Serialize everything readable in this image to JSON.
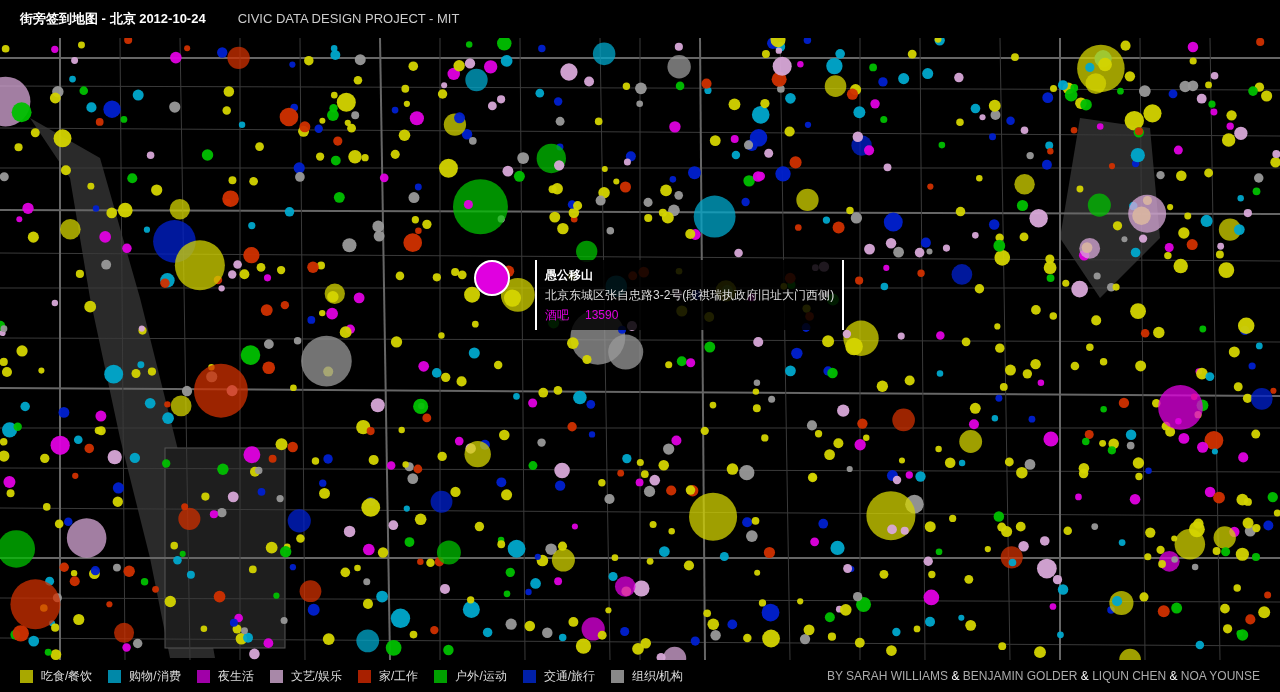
{
  "header": {
    "title": "街旁签到地图 - 北京 2012-10-24",
    "subtitle": "CIVIC DATA DESIGN PROJECT - MIT"
  },
  "tooltip": {
    "name": "愚公移山",
    "address": "北京东城区张自忠路3-2号(段祺瑞执政府旧址大门西侧)",
    "category": "酒吧",
    "count": "13590",
    "color": "#e000e0"
  },
  "legend": [
    {
      "label": "吃食/餐饮",
      "color": "#a8a800"
    },
    {
      "label": "购物/消费",
      "color": "#0088a8"
    },
    {
      "label": "夜生活",
      "color": "#a000a8"
    },
    {
      "label": "文艺/娱乐",
      "color": "#a888a8"
    },
    {
      "label": "家/工作",
      "color": "#a82000"
    },
    {
      "label": "户外/运动",
      "color": "#00a000"
    },
    {
      "label": "交通/旅行",
      "color": "#0020a8"
    },
    {
      "label": "组织/机构",
      "color": "#888888"
    }
  ],
  "credits": {
    "names": [
      "BY SARAH WILLIAMS",
      "BENJAMIN GOLDER",
      "LIQUN CHEN",
      "NOA YOUNSE"
    ],
    "separator": "&"
  }
}
